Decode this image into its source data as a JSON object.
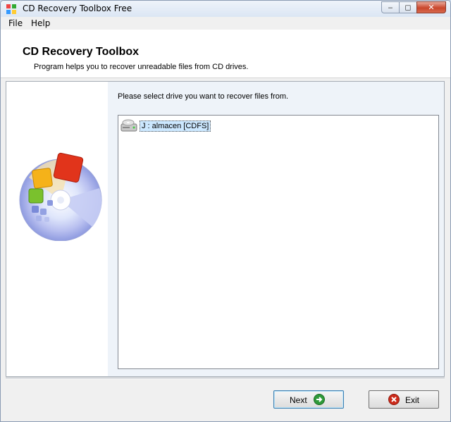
{
  "window": {
    "title": "CD Recovery Toolbox Free"
  },
  "caption_buttons": {
    "minimize_icon": "minimize-icon",
    "maximize_icon": "maximize-icon",
    "close_icon": "close-icon"
  },
  "menu": {
    "items": [
      "File",
      "Help"
    ]
  },
  "header": {
    "title": "CD Recovery Toolbox",
    "subtitle": "Program helps you to recover unreadable files from CD drives."
  },
  "main": {
    "prompt": "Please select drive you want to recover files from.",
    "drives": [
      {
        "label": "J : almacen [CDFS]",
        "icon": "cd-drive-icon",
        "selected": true
      }
    ]
  },
  "footer": {
    "next_label": "Next",
    "next_icon": "arrow-right-icon",
    "exit_label": "Exit",
    "exit_icon": "close-circle-icon"
  },
  "colors": {
    "accent_green": "#2e9a3a",
    "exit_red": "#cc2a1a",
    "selection": "#cce8ff"
  }
}
